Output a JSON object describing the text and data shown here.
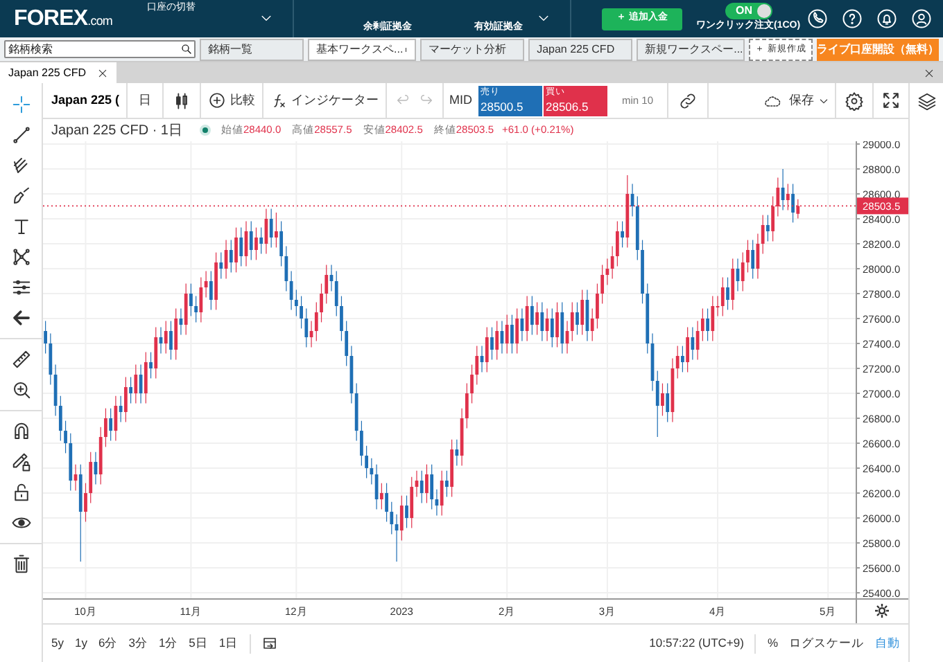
{
  "top_bar": {
    "logo": "FOREX",
    "logo_suffix": ".com",
    "account_switch": "口座の切替",
    "margin_labels": [
      "余剰証拠金",
      "有効証拠金"
    ],
    "deposit_button": "＋ 追加入金",
    "one_click": {
      "toggle": "ON",
      "on": true,
      "label": "ワンクリック注文(1CO)"
    }
  },
  "workspace_tabs": {
    "search": {
      "placeholder": "銘柄検索"
    },
    "tabs": [
      {
        "label": "銘柄一覧",
        "selected": false
      },
      {
        "label": "基本ワークスペ...",
        "selected": true
      },
      {
        "label": "マーケット分析",
        "selected": false
      },
      {
        "label": "Japan 225 CFD",
        "selected": false
      },
      {
        "label": "新規ワークスペー...",
        "selected": false
      }
    ],
    "new_button": "＋ 新規作成",
    "live_account_button": "ライブ口座開設（無料）"
  },
  "panel_tab": {
    "label": "Japan 225 CFD"
  },
  "toolbar": {
    "symbol": "Japan 225 (",
    "interval": "日",
    "compare": "比較",
    "indicators": "インジケーター",
    "price_mode": "MID",
    "sell": {
      "label": "売り",
      "price": "28500.5"
    },
    "buy": {
      "label": "買い",
      "price": "28506.5"
    },
    "min_lot": "min 10",
    "save": "保存"
  },
  "tools": [
    {
      "kind": "crosshair",
      "selected": true
    },
    {
      "kind": "line",
      "selected": false
    },
    {
      "kind": "fork",
      "selected": false
    },
    {
      "kind": "brush",
      "selected": false
    },
    {
      "kind": "text",
      "selected": false
    },
    {
      "kind": "pattern",
      "selected": false
    },
    {
      "kind": "levels",
      "selected": false
    },
    {
      "kind": "back",
      "selected": false
    },
    {
      "kind": "ruler",
      "selected": false
    },
    {
      "kind": "zoom",
      "selected": false
    },
    {
      "kind": "magnet",
      "selected": false
    },
    {
      "kind": "lock-draw",
      "selected": false
    },
    {
      "kind": "lock",
      "selected": false
    },
    {
      "kind": "eye",
      "selected": false
    },
    {
      "kind": "trash",
      "selected": false
    }
  ],
  "chart_header": {
    "title": "Japan 225 CFD · 1日",
    "ohlc": [
      {
        "label": "始値",
        "value": "28440.0"
      },
      {
        "label": "高値",
        "value": "28557.5"
      },
      {
        "label": "安値",
        "value": "28402.5"
      },
      {
        "label": "終値",
        "value": "28503.5"
      }
    ],
    "change": "+61.0 (+0.21%)"
  },
  "chart": {
    "chart_data": {
      "type": "candlestick",
      "grid": true,
      "ylim": [
        25356,
        29022
      ],
      "ref_lines": [
        {
          "axis": "y",
          "value": 28503.5,
          "label": "28503.5",
          "color": "#e0314b"
        }
      ],
      "categories": [
        null,
        null,
        null,
        null,
        null,
        null,
        null,
        null,
        "10月",
        null,
        null,
        null,
        null,
        null,
        null,
        null,
        null,
        null,
        null,
        null,
        null,
        null,
        null,
        null,
        null,
        null,
        null,
        null,
        null,
        "11月",
        null,
        null,
        null,
        null,
        null,
        null,
        null,
        null,
        null,
        null,
        null,
        null,
        null,
        null,
        null,
        null,
        null,
        null,
        null,
        null,
        "12月",
        null,
        null,
        null,
        null,
        null,
        null,
        null,
        null,
        null,
        null,
        null,
        null,
        null,
        null,
        null,
        null,
        null,
        null,
        null,
        null,
        "2023",
        null,
        null,
        null,
        null,
        null,
        null,
        null,
        null,
        null,
        null,
        null,
        null,
        null,
        null,
        null,
        null,
        null,
        null,
        null,
        null,
        "2月",
        null,
        null,
        null,
        null,
        null,
        null,
        null,
        null,
        null,
        null,
        null,
        null,
        null,
        null,
        null,
        null,
        null,
        null,
        null,
        "3月",
        null,
        null,
        null,
        null,
        null,
        null,
        null,
        null,
        null,
        null,
        null,
        null,
        null,
        null,
        null,
        null,
        null,
        null,
        null,
        null,
        null,
        "4月",
        null,
        null,
        null,
        null,
        null,
        null,
        null,
        null,
        null,
        null,
        null,
        null,
        null,
        null,
        null,
        null,
        null,
        null,
        null,
        null,
        null,
        "5月",
        null,
        null,
        null,
        null,
        null
      ],
      "ohlc": [
        [
          27500,
          27580,
          27320,
          27400
        ],
        [
          27400,
          27480,
          27070,
          27150
        ],
        [
          27150,
          27230,
          26820,
          26900
        ],
        [
          26900,
          26980,
          26620,
          26700
        ],
        [
          26700,
          26780,
          26520,
          26600
        ],
        [
          26600,
          26680,
          26220,
          26300
        ],
        [
          26300,
          26430,
          26220,
          26350
        ],
        [
          26350,
          26430,
          25650,
          26050
        ],
        [
          26050,
          26280,
          25970,
          26200
        ],
        [
          26200,
          26530,
          26120,
          26450
        ],
        [
          26450,
          26530,
          26270,
          26350
        ],
        [
          26350,
          26730,
          26270,
          26650
        ],
        [
          26650,
          26880,
          26570,
          26800
        ],
        [
          26800,
          26880,
          26620,
          26700
        ],
        [
          26700,
          26980,
          26620,
          26900
        ],
        [
          26900,
          26980,
          26770,
          26850
        ],
        [
          26850,
          27130,
          26770,
          27050
        ],
        [
          27050,
          27130,
          26920,
          27000
        ],
        [
          27000,
          27230,
          26920,
          27150
        ],
        [
          27150,
          27230,
          26920,
          27000
        ],
        [
          27000,
          27330,
          26920,
          27250
        ],
        [
          27250,
          27330,
          27120,
          27200
        ],
        [
          27200,
          27530,
          27120,
          27450
        ],
        [
          27450,
          27530,
          27320,
          27400
        ],
        [
          27400,
          27580,
          27320,
          27500
        ],
        [
          27500,
          27580,
          27270,
          27350
        ],
        [
          27350,
          27680,
          27270,
          27600
        ],
        [
          27600,
          27680,
          27470,
          27550
        ],
        [
          27550,
          27880,
          27470,
          27800
        ],
        [
          27800,
          27880,
          27620,
          27700
        ],
        [
          27700,
          27780,
          27570,
          27650
        ],
        [
          27650,
          27930,
          27570,
          27850
        ],
        [
          27850,
          27980,
          27770,
          27900
        ],
        [
          27900,
          27980,
          27670,
          27750
        ],
        [
          27750,
          28130,
          27670,
          28050
        ],
        [
          28050,
          28130,
          27920,
          28000
        ],
        [
          28000,
          28230,
          27920,
          28150
        ],
        [
          28150,
          28230,
          27970,
          28050
        ],
        [
          28050,
          28330,
          27970,
          28250
        ],
        [
          28250,
          28330,
          28020,
          28100
        ],
        [
          28100,
          28380,
          28020,
          28300
        ],
        [
          28300,
          28380,
          28070,
          28150
        ],
        [
          28150,
          28330,
          28070,
          28250
        ],
        [
          28250,
          28330,
          28120,
          28200
        ],
        [
          28200,
          28480,
          28120,
          28400
        ],
        [
          28400,
          28480,
          28170,
          28250
        ],
        [
          28250,
          28450,
          28170,
          28300
        ],
        [
          28300,
          28380,
          28020,
          28100
        ],
        [
          28100,
          28180,
          27820,
          27900
        ],
        [
          27900,
          27980,
          27670,
          27750
        ],
        [
          27750,
          27830,
          27620,
          27700
        ],
        [
          27700,
          27780,
          27520,
          27600
        ],
        [
          27600,
          27680,
          27370,
          27450
        ],
        [
          27450,
          27580,
          27370,
          27500
        ],
        [
          27500,
          27730,
          27420,
          27650
        ],
        [
          27650,
          27880,
          27570,
          27800
        ],
        [
          27800,
          28030,
          27720,
          27950
        ],
        [
          27950,
          28030,
          27820,
          27900
        ],
        [
          27900,
          27980,
          27620,
          27700
        ],
        [
          27700,
          27780,
          27420,
          27500
        ],
        [
          27500,
          27580,
          27220,
          27300
        ],
        [
          27300,
          27380,
          26920,
          27000
        ],
        [
          27000,
          27080,
          26620,
          26700
        ],
        [
          26700,
          26780,
          26420,
          26500
        ],
        [
          26500,
          26580,
          26320,
          26400
        ],
        [
          26400,
          26480,
          26270,
          26350
        ],
        [
          26350,
          26430,
          26070,
          26150
        ],
        [
          26150,
          26280,
          26070,
          26200
        ],
        [
          26200,
          26280,
          25970,
          26050
        ],
        [
          26050,
          26130,
          25870,
          25950
        ],
        [
          25950,
          26030,
          25650,
          25900
        ],
        [
          25900,
          26180,
          25820,
          26100
        ],
        [
          26100,
          26180,
          25920,
          26000
        ],
        [
          26000,
          26330,
          25920,
          26250
        ],
        [
          26250,
          26380,
          26170,
          26300
        ],
        [
          26300,
          26380,
          26120,
          26200
        ],
        [
          26200,
          26430,
          26120,
          26350
        ],
        [
          26350,
          26430,
          26070,
          26150
        ],
        [
          26150,
          26230,
          26020,
          26100
        ],
        [
          26100,
          26380,
          26020,
          26300
        ],
        [
          26300,
          26380,
          26170,
          26250
        ],
        [
          26250,
          26630,
          26170,
          26550
        ],
        [
          26550,
          26630,
          26420,
          26500
        ],
        [
          26500,
          26880,
          26420,
          26800
        ],
        [
          26800,
          27080,
          26720,
          27000
        ],
        [
          27000,
          27230,
          26920,
          27150
        ],
        [
          27150,
          27380,
          27070,
          27300
        ],
        [
          27300,
          27380,
          27170,
          27250
        ],
        [
          27250,
          27530,
          27170,
          27450
        ],
        [
          27450,
          27530,
          27270,
          27350
        ],
        [
          27350,
          27580,
          27270,
          27500
        ],
        [
          27500,
          27580,
          27320,
          27400
        ],
        [
          27400,
          27630,
          27320,
          27550
        ],
        [
          27550,
          27630,
          27320,
          27400
        ],
        [
          27400,
          27680,
          27320,
          27600
        ],
        [
          27600,
          27680,
          27420,
          27500
        ],
        [
          27500,
          27780,
          27420,
          27700
        ],
        [
          27700,
          27780,
          27470,
          27550
        ],
        [
          27550,
          27730,
          27470,
          27650
        ],
        [
          27650,
          27730,
          27420,
          27500
        ],
        [
          27500,
          27680,
          27420,
          27600
        ],
        [
          27600,
          27680,
          27370,
          27450
        ],
        [
          27450,
          27730,
          27370,
          27650
        ],
        [
          27650,
          27730,
          27320,
          27400
        ],
        [
          27400,
          27580,
          27320,
          27500
        ],
        [
          27500,
          27730,
          27420,
          27650
        ],
        [
          27650,
          27730,
          27470,
          27550
        ],
        [
          27550,
          27830,
          27470,
          27750
        ],
        [
          27750,
          27830,
          27420,
          27500
        ],
        [
          27500,
          27680,
          27420,
          27600
        ],
        [
          27600,
          27880,
          27520,
          27800
        ],
        [
          27800,
          28030,
          27720,
          27950
        ],
        [
          27950,
          28080,
          27870,
          28000
        ],
        [
          28000,
          28180,
          27920,
          28100
        ],
        [
          28100,
          28380,
          28020,
          28300
        ],
        [
          28300,
          28380,
          28170,
          28250
        ],
        [
          28250,
          28750,
          28170,
          28600
        ],
        [
          28600,
          28680,
          28420,
          28500
        ],
        [
          28500,
          28580,
          28070,
          28150
        ],
        [
          28150,
          28230,
          27720,
          27800
        ],
        [
          27800,
          27880,
          27320,
          27400
        ],
        [
          27400,
          27480,
          27020,
          27100
        ],
        [
          27100,
          27180,
          26650,
          26900
        ],
        [
          26900,
          27080,
          26820,
          27000
        ],
        [
          27000,
          27080,
          26770,
          26850
        ],
        [
          26850,
          27280,
          26770,
          27200
        ],
        [
          27200,
          27380,
          27120,
          27300
        ],
        [
          27300,
          27380,
          27170,
          27250
        ],
        [
          27250,
          27530,
          27170,
          27450
        ],
        [
          27450,
          27530,
          27270,
          27350
        ],
        [
          27350,
          27580,
          27270,
          27500
        ],
        [
          27500,
          27680,
          27420,
          27600
        ],
        [
          27600,
          27680,
          27420,
          27500
        ],
        [
          27500,
          27780,
          27420,
          27700
        ],
        [
          27700,
          27780,
          27620,
          27700
        ],
        [
          27700,
          27930,
          27620,
          27850
        ],
        [
          27850,
          27930,
          27670,
          27750
        ],
        [
          27750,
          28080,
          27670,
          28000
        ],
        [
          28000,
          28080,
          27820,
          27900
        ],
        [
          27900,
          28130,
          27820,
          28050
        ],
        [
          28050,
          28230,
          27970,
          28150
        ],
        [
          28150,
          28230,
          27920,
          28000
        ],
        [
          28000,
          28280,
          27920,
          28200
        ],
        [
          28200,
          28430,
          28120,
          28350
        ],
        [
          28350,
          28430,
          28220,
          28300
        ],
        [
          28300,
          28580,
          28220,
          28500
        ],
        [
          28500,
          28730,
          28420,
          28650
        ],
        [
          28650,
          28800,
          28470,
          28550
        ],
        [
          28550,
          28680,
          28470,
          28600
        ],
        [
          28600,
          28680,
          28370,
          28450
        ],
        [
          28440,
          28557.5,
          28402.5,
          28503.5
        ],
        null,
        null,
        null,
        null,
        null,
        null,
        null,
        null,
        null,
        null,
        null
      ],
      "yticks": [
        {
          "value": 29000,
          "label": "29000.0"
        },
        {
          "value": 28800,
          "label": "28800.0"
        },
        {
          "value": 28600,
          "label": "28600.0"
        },
        {
          "value": 28400,
          "label": "28400.0"
        },
        {
          "value": 28200,
          "label": "28200.0"
        },
        {
          "value": 28000,
          "label": "28000.0"
        },
        {
          "value": 27800,
          "label": "27800.0"
        },
        {
          "value": 27600,
          "label": "27600.0"
        },
        {
          "value": 27400,
          "label": "27400.0"
        },
        {
          "value": 27200,
          "label": "27200.0"
        },
        {
          "value": 27000,
          "label": "27000.0"
        },
        {
          "value": 26800,
          "label": "26800.0"
        },
        {
          "value": 26600,
          "label": "26600.0"
        },
        {
          "value": 26400,
          "label": "26400.0"
        },
        {
          "value": 26200,
          "label": "26200.0"
        },
        {
          "value": 26000,
          "label": "26000.0"
        },
        {
          "value": 25800,
          "label": "25800.0"
        },
        {
          "value": 25600,
          "label": "25600.0"
        },
        {
          "value": 25400,
          "label": "25400.0"
        }
      ]
    }
  },
  "bottom_bar": {
    "ranges": [
      "5y",
      "1y",
      "6分",
      "3分",
      "1分",
      "5日",
      "1日"
    ],
    "clock": "10:57:22 (UTC+9)",
    "percent": "%",
    "log_scale": "ログスケール",
    "auto": {
      "label": "自動",
      "on": true
    }
  }
}
